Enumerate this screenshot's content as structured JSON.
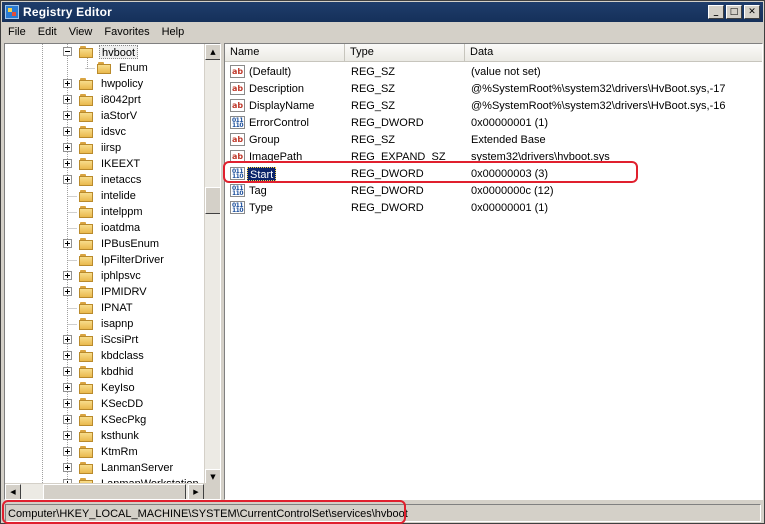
{
  "window": {
    "title": "Registry Editor"
  },
  "window_controls": {
    "minimize": "_",
    "maximize": "□",
    "close": "✕"
  },
  "menu": [
    "File",
    "Edit",
    "View",
    "Favorites",
    "Help"
  ],
  "tree": {
    "items": [
      {
        "label": "hvboot",
        "expander": "minus",
        "depth": 0,
        "selected": true
      },
      {
        "label": "Enum",
        "expander": "none",
        "depth": 1
      },
      {
        "label": "hwpolicy",
        "expander": "plus",
        "depth": 0
      },
      {
        "label": "i8042prt",
        "expander": "plus",
        "depth": 0
      },
      {
        "label": "iaStorV",
        "expander": "plus",
        "depth": 0
      },
      {
        "label": "idsvc",
        "expander": "plus",
        "depth": 0
      },
      {
        "label": "iirsp",
        "expander": "plus",
        "depth": 0
      },
      {
        "label": "IKEEXT",
        "expander": "plus",
        "depth": 0
      },
      {
        "label": "inetaccs",
        "expander": "plus",
        "depth": 0
      },
      {
        "label": "intelide",
        "expander": "none",
        "depth": 0
      },
      {
        "label": "intelppm",
        "expander": "none",
        "depth": 0
      },
      {
        "label": "ioatdma",
        "expander": "none",
        "depth": 0
      },
      {
        "label": "IPBusEnum",
        "expander": "plus",
        "depth": 0
      },
      {
        "label": "IpFilterDriver",
        "expander": "none",
        "depth": 0
      },
      {
        "label": "iphlpsvc",
        "expander": "plus",
        "depth": 0
      },
      {
        "label": "IPMIDRV",
        "expander": "plus",
        "depth": 0
      },
      {
        "label": "IPNAT",
        "expander": "none",
        "depth": 0
      },
      {
        "label": "isapnp",
        "expander": "none",
        "depth": 0
      },
      {
        "label": "iScsiPrt",
        "expander": "plus",
        "depth": 0
      },
      {
        "label": "kbdclass",
        "expander": "plus",
        "depth": 0
      },
      {
        "label": "kbdhid",
        "expander": "plus",
        "depth": 0
      },
      {
        "label": "KeyIso",
        "expander": "plus",
        "depth": 0
      },
      {
        "label": "KSecDD",
        "expander": "plus",
        "depth": 0
      },
      {
        "label": "KSecPkg",
        "expander": "plus",
        "depth": 0
      },
      {
        "label": "ksthunk",
        "expander": "plus",
        "depth": 0
      },
      {
        "label": "KtmRm",
        "expander": "plus",
        "depth": 0
      },
      {
        "label": "LanmanServer",
        "expander": "plus",
        "depth": 0
      },
      {
        "label": "LanmanWorkstation",
        "expander": "plus",
        "depth": 0
      }
    ]
  },
  "list": {
    "columns": [
      "Name",
      "Type",
      "Data"
    ],
    "rows": [
      {
        "icon": "ab",
        "name": "(Default)",
        "type": "REG_SZ",
        "data": "(value not set)"
      },
      {
        "icon": "ab",
        "name": "Description",
        "type": "REG_SZ",
        "data": "@%SystemRoot%\\system32\\drivers\\HvBoot.sys,-17"
      },
      {
        "icon": "ab",
        "name": "DisplayName",
        "type": "REG_SZ",
        "data": "@%SystemRoot%\\system32\\drivers\\HvBoot.sys,-16"
      },
      {
        "icon": "bin",
        "name": "ErrorControl",
        "type": "REG_DWORD",
        "data": "0x00000001 (1)"
      },
      {
        "icon": "ab",
        "name": "Group",
        "type": "REG_SZ",
        "data": "Extended Base"
      },
      {
        "icon": "ab",
        "name": "ImagePath",
        "type": "REG_EXPAND_SZ",
        "data": "system32\\drivers\\hvboot.sys"
      },
      {
        "icon": "bin",
        "name": "Start",
        "type": "REG_DWORD",
        "data": "0x00000003 (3)",
        "selected": true
      },
      {
        "icon": "bin",
        "name": "Tag",
        "type": "REG_DWORD",
        "data": "0x0000000c (12)"
      },
      {
        "icon": "bin",
        "name": "Type",
        "type": "REG_DWORD",
        "data": "0x00000001 (1)"
      }
    ]
  },
  "status": {
    "path": "Computer\\HKEY_LOCAL_MACHINE\\SYSTEM\\CurrentControlSet\\services\\hvboot"
  },
  "icons": {
    "string_value": "ab",
    "binary_value": "011 110"
  },
  "colors": {
    "highlight_box": "#e0202e",
    "selection": "#0a246a",
    "titlebar": "#1f3d6b"
  }
}
